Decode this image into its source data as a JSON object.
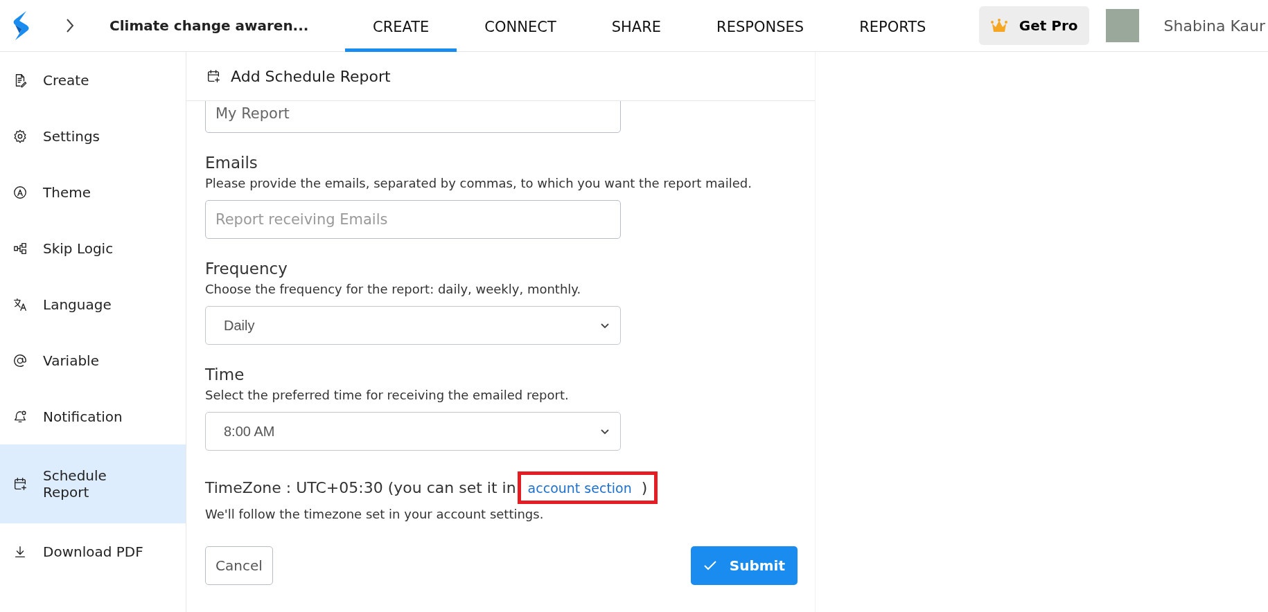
{
  "topbar": {
    "breadcrumb_title": "Climate change awaren...",
    "get_pro": "Get Pro",
    "user_name": "Shabina Kaur",
    "tabs": [
      {
        "label": "CREATE",
        "selected": true
      },
      {
        "label": "CONNECT",
        "selected": false
      },
      {
        "label": "SHARE",
        "selected": false
      },
      {
        "label": "RESPONSES",
        "selected": false
      },
      {
        "label": "REPORTS",
        "selected": false
      }
    ]
  },
  "sidebar": {
    "items": [
      {
        "label": "Create",
        "selected": false
      },
      {
        "label": "Settings",
        "selected": false
      },
      {
        "label": "Theme",
        "selected": false
      },
      {
        "label": "Skip Logic",
        "selected": false
      },
      {
        "label": "Language",
        "selected": false
      },
      {
        "label": "Variable",
        "selected": false
      },
      {
        "label": "Notification",
        "selected": false
      },
      {
        "label": "Schedule Report",
        "selected": true
      },
      {
        "label": "Download PDF",
        "selected": false
      }
    ]
  },
  "panel": {
    "title": "Add Schedule Report",
    "fields": [
      {
        "kind": "input",
        "value": "My Report"
      },
      {
        "kind": "input",
        "label": "Emails",
        "description": "Please provide the emails, separated by commas, to which you want the report mailed.",
        "placeholder": "Report receiving Emails"
      },
      {
        "kind": "select",
        "label": "Frequency",
        "description": "Choose the frequency for the report: daily, weekly, monthly.",
        "value": "Daily"
      },
      {
        "kind": "select",
        "label": "Time",
        "description": "Select the preferred time for receiving the emailed report.",
        "value": "8:00 AM"
      }
    ],
    "timezone": {
      "text": "TimeZone : UTC+05:30 (you can set it in",
      "link": "account section",
      "closing": ")",
      "highlighted": true,
      "note": "We'll follow the timezone set in your account settings."
    },
    "buttons": {
      "cancel": "Cancel",
      "submit": "Submit"
    }
  }
}
